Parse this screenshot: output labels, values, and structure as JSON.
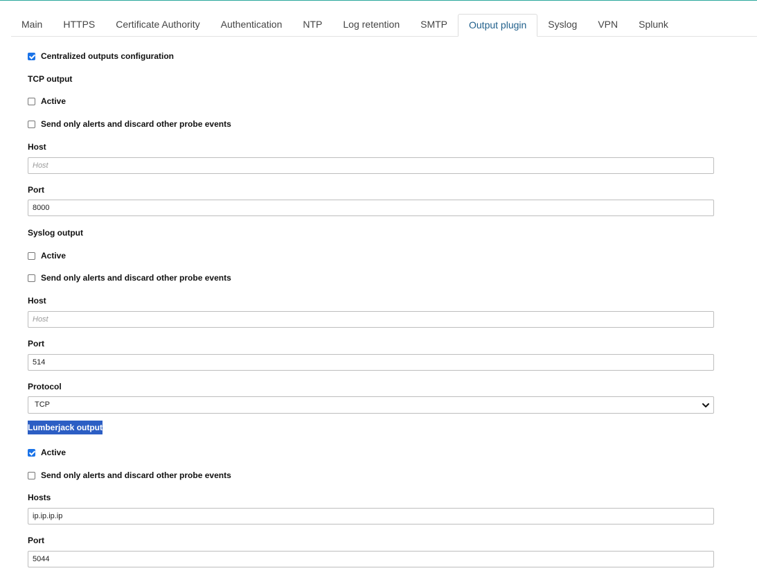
{
  "tabs": [
    {
      "label": "Main",
      "active": false
    },
    {
      "label": "HTTPS",
      "active": false
    },
    {
      "label": "Certificate Authority",
      "active": false
    },
    {
      "label": "Authentication",
      "active": false
    },
    {
      "label": "NTP",
      "active": false
    },
    {
      "label": "Log retention",
      "active": false
    },
    {
      "label": "SMTP",
      "active": false
    },
    {
      "label": "Output plugin",
      "active": true
    },
    {
      "label": "Syslog",
      "active": false
    },
    {
      "label": "VPN",
      "active": false
    },
    {
      "label": "Splunk",
      "active": false
    }
  ],
  "centralized": {
    "label": "Centralized outputs configuration",
    "checked": true
  },
  "tcp": {
    "heading": "TCP output",
    "active_label": "Active",
    "active_checked": false,
    "alerts_label": "Send only alerts and discard other probe events",
    "alerts_checked": false,
    "host_label": "Host",
    "host_value": "",
    "host_placeholder": "Host",
    "port_label": "Port",
    "port_value": "8000"
  },
  "syslog": {
    "heading": "Syslog output",
    "active_label": "Active",
    "active_checked": false,
    "alerts_label": "Send only alerts and discard other probe events",
    "alerts_checked": false,
    "host_label": "Host",
    "host_value": "",
    "host_placeholder": "Host",
    "port_label": "Port",
    "port_value": "514",
    "protocol_label": "Protocol",
    "protocol_value": "TCP"
  },
  "lumberjack": {
    "heading": "Lumberjack output",
    "active_label": "Active",
    "active_checked": true,
    "alerts_label": "Send only alerts and discard other probe events",
    "alerts_checked": false,
    "hosts_label": "Hosts",
    "hosts_value": "ip.ip.ip.ip",
    "port_label": "Port",
    "port_value": "5044"
  },
  "colors": {
    "accent": "#1f5f8b",
    "checkbox": "#1a73e8",
    "highlight": "#2c5ec4",
    "topline": "#2aa79b"
  },
  "icons": {
    "select_arrow": "chevron-down-icon",
    "checkmark": "checkmark-icon"
  }
}
